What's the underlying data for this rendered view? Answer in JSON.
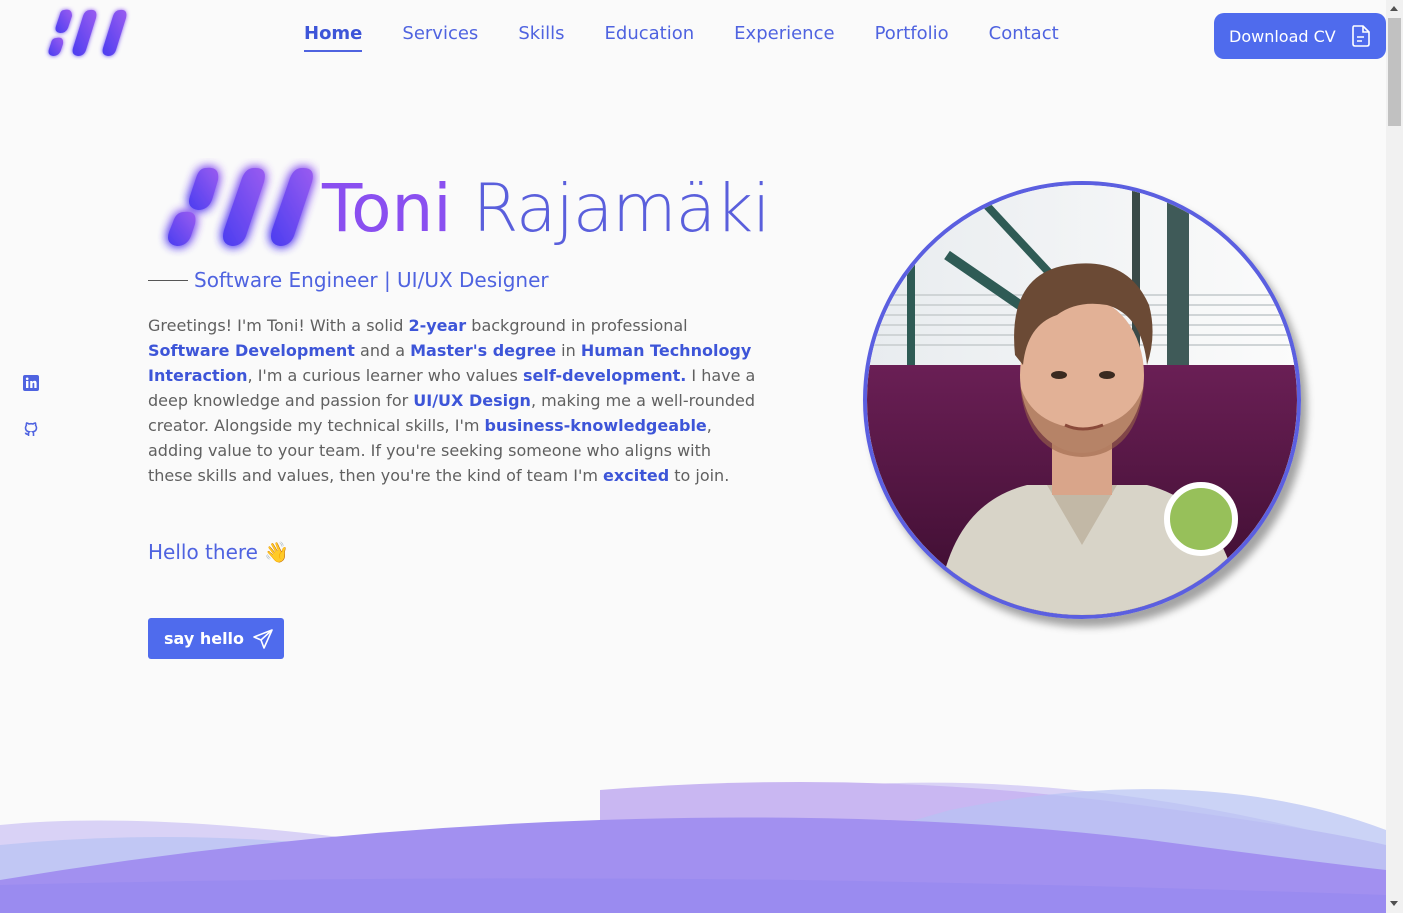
{
  "nav": {
    "items": [
      {
        "label": "Home",
        "active": true
      },
      {
        "label": "Services",
        "active": false
      },
      {
        "label": "Skills",
        "active": false
      },
      {
        "label": "Education",
        "active": false
      },
      {
        "label": "Experience",
        "active": false
      },
      {
        "label": "Portfolio",
        "active": false
      },
      {
        "label": "Contact",
        "active": false
      }
    ],
    "cv_button": "Download CV",
    "cv_icon": "document-icon"
  },
  "social": {
    "icons": [
      "linkedin-icon",
      "github-icon"
    ]
  },
  "hero": {
    "first_name": "Toni",
    "last_name": "Rajamäki",
    "subtitle": "Software Engineer | UI/UX Designer",
    "bio": [
      {
        "t": "Greetings! I'm Toni! With a solid ",
        "b": false
      },
      {
        "t": "2-year",
        "b": true
      },
      {
        "t": " background in professional ",
        "b": false
      },
      {
        "t": "Software Development",
        "b": true
      },
      {
        "t": " and a ",
        "b": false
      },
      {
        "t": "Master's degree",
        "b": true
      },
      {
        "t": " in ",
        "b": false
      },
      {
        "t": "Human Technology Interaction",
        "b": true
      },
      {
        "t": ", I'm a curious learner who values ",
        "b": false
      },
      {
        "t": "self-development.",
        "b": true
      },
      {
        "t": " I have a deep knowledge and passion for ",
        "b": false
      },
      {
        "t": "UI/UX Design",
        "b": true
      },
      {
        "t": ", making me a well-rounded creator. Alongside my technical skills, I'm ",
        "b": false
      },
      {
        "t": "business-knowledgeable",
        "b": true
      },
      {
        "t": ", adding value to your team. If you're seeking someone who aligns with these skills and values, then you're the kind of team I'm ",
        "b": false
      },
      {
        "t": "excited",
        "b": true
      },
      {
        "t": " to join.",
        "b": false
      }
    ],
    "hello": "Hello there 👋",
    "say_hello_button": "say hello",
    "say_hello_icon": "send-icon"
  },
  "colors": {
    "accent": "#4f6bed",
    "name_first": "#8a4ff0",
    "name_last": "#5a5fdc",
    "status": "#97c05a"
  }
}
